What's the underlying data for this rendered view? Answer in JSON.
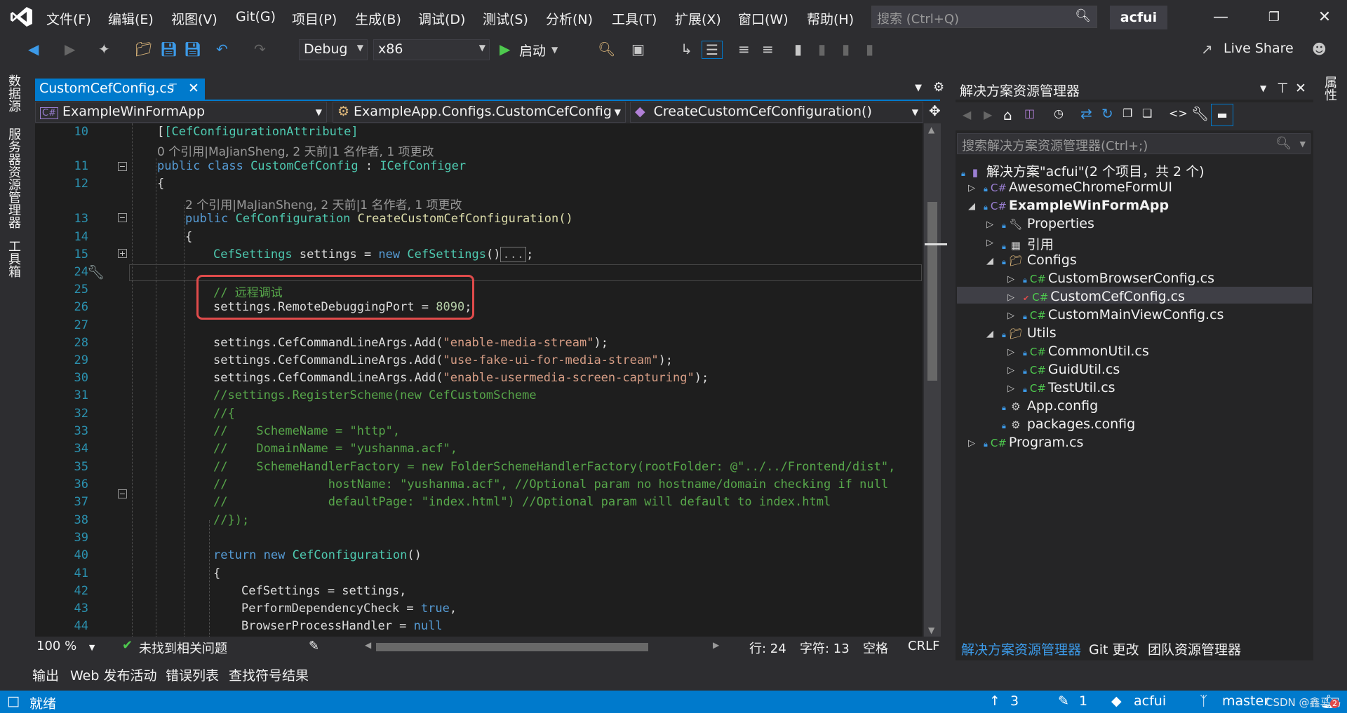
{
  "menu": [
    "文件(F)",
    "编辑(E)",
    "视图(V)",
    "Git(G)",
    "项目(P)",
    "生成(B)",
    "调试(D)",
    "测试(S)",
    "分析(N)",
    "工具(T)",
    "扩展(X)",
    "窗口(W)",
    "帮助(H)"
  ],
  "search_placeholder": "搜索 (Ctrl+Q)",
  "solution_badge": "acfui",
  "toolbar": {
    "config": "Debug",
    "platform": "x86",
    "start": "启动",
    "live_share": "Live Share"
  },
  "left_tabs": [
    "数据源",
    "服务器资源管理器",
    "工具箱"
  ],
  "right_tabs": [
    "属性"
  ],
  "doc_tab": "CustomCefConfig.cs",
  "nav": {
    "project": "ExampleWinFormApp",
    "class": "ExampleApp.Configs.CustomCefConfig",
    "member": "CreateCustomCefConfiguration()"
  },
  "line_numbers": [
    "10",
    "",
    "11",
    "12",
    "",
    "13",
    "14",
    "15",
    "24",
    "25",
    "26",
    "27",
    "28",
    "29",
    "30",
    "31",
    "32",
    "33",
    "34",
    "35",
    "36",
    "37",
    "38",
    "39",
    "40",
    "41",
    "42",
    "43",
    "44"
  ],
  "code": {
    "l10": "[CefConfigurationAttribute]",
    "lens1": "0 个引用|MaJianSheng, 2 天前|1 名作者, 1 项更改",
    "l11_kw": "public class ",
    "l11_ty": "CustomCefConfig",
    "l11_rest": " : ",
    "l11_iface": "ICefConfiger",
    "l12": "{",
    "lens2": "2 个引用|MaJianSheng, 2 天前|1 名作者, 1 项更改",
    "l13_kw": "public ",
    "l13_ty": "CefConfiguration",
    "l13_name": " CreateCustomCefConfiguration()",
    "l14": "{",
    "l15_ty": "CefSettings",
    "l15_mid": " settings = ",
    "l15_kw": "new ",
    "l15_ty2": "CefSettings",
    "l15_end": "()",
    "l15_box": "...",
    "l15_semi": ";",
    "l25": "// 远程调试",
    "l26_a": "settings.RemoteDebuggingPort = ",
    "l26_num": "8090",
    "l26_b": ";",
    "l28_a": "settings.CefCommandLineArgs.Add(",
    "l28_s": "\"enable-media-stream\"",
    "l28_b": ");",
    "l29_a": "settings.CefCommandLineArgs.Add(",
    "l29_s": "\"use-fake-ui-for-media-stream\"",
    "l29_b": ");",
    "l30_a": "settings.CefCommandLineArgs.Add(",
    "l30_s": "\"enable-usermedia-screen-capturing\"",
    "l30_b": ");",
    "l31": "//settings.RegisterScheme(new CefCustomScheme",
    "l32": "//{",
    "l33": "//    SchemeName = \"http\",",
    "l34": "//    DomainName = \"yushanma.acf\",",
    "l35": "//    SchemeHandlerFactory = new FolderSchemeHandlerFactory(rootFolder: @\"../../Frontend/dist\",",
    "l36": "//              hostName: \"yushanma.acf\", //Optional param no hostname/domain checking if null",
    "l37": "//              defaultPage: \"index.html\") //Optional param will default to index.html",
    "l38": "//});",
    "l40_kw": "return new ",
    "l40_ty": "CefConfiguration",
    "l40_end": "()",
    "l41": "{",
    "l42_ty": "CefSettings",
    "l42_end": " = settings,",
    "l43_a": "PerformDependencyCheck = ",
    "l43_kw": "true",
    ",": ",",
    "l43_b": ",",
    "l44_a": "BrowserProcessHandler = ",
    "l44_kw": "null"
  },
  "editor_status": {
    "zoom": "100 %",
    "issues": "未找到相关问题",
    "line": "行: 24",
    "col": "字符: 13",
    "ws": "空格",
    "eol": "CRLF"
  },
  "solution_explorer": {
    "title": "解决方案资源管理器",
    "search": "搜索解决方案资源管理器(Ctrl+;)",
    "items": [
      "解决方案\"acfui\"(2 个项目，共 2 个)",
      "AwesomeChromeFormUI",
      "ExampleWinFormApp",
      "Properties",
      "引用",
      "Configs",
      "CustomBrowserConfig.cs",
      "CustomCefConfig.cs",
      "CustomMainViewConfig.cs",
      "Utils",
      "CommonUtil.cs",
      "GuidUtil.cs",
      "TestUtil.cs",
      "App.config",
      "packages.config",
      "Program.cs"
    ],
    "tabs": [
      "解决方案资源管理器",
      "Git 更改",
      "团队资源管理器"
    ]
  },
  "bottom_tabs": [
    "输出",
    "Web 发布活动",
    "错误列表",
    "查找符号结果"
  ],
  "statusbar": {
    "ready": "就绪",
    "up": "3",
    "edits": "1",
    "repo": "acfui",
    "branch": "master",
    "watermark": "CSDN @鑫马马",
    "notif": "2"
  },
  "colors": {
    "accent": "#007acc",
    "highlight_box": "#e04b4b"
  }
}
